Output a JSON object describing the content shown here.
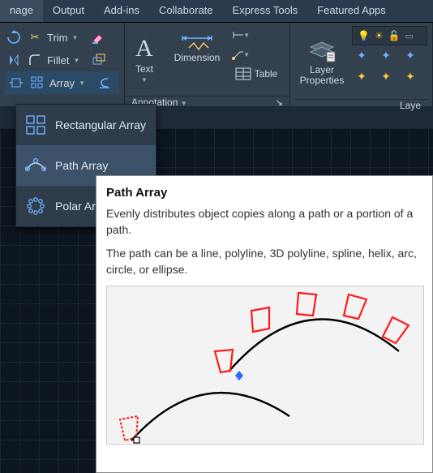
{
  "menubar": [
    "nage",
    "Output",
    "Add-ins",
    "Collaborate",
    "Express Tools",
    "Featured Apps"
  ],
  "ribbon": {
    "modify": {
      "trim": "Trim",
      "fillet": "Fillet",
      "array": "Array"
    },
    "annotation": {
      "text": "Text",
      "dimension": "Dimension",
      "table": "Table",
      "panel": "Annotation"
    },
    "layers": {
      "label": "Layer\nProperties",
      "right_label": "Laye"
    }
  },
  "array_menu": {
    "rect": "Rectangular Array",
    "path": "Path Array",
    "polar": "Polar Ar"
  },
  "tooltip": {
    "title": "Path Array",
    "desc": "Evenly distributes object copies along a path or a portion of a path.",
    "detail": "The path can be a line, polyline, 3D polyline, spline, helix, arc, circle, or ellipse."
  }
}
